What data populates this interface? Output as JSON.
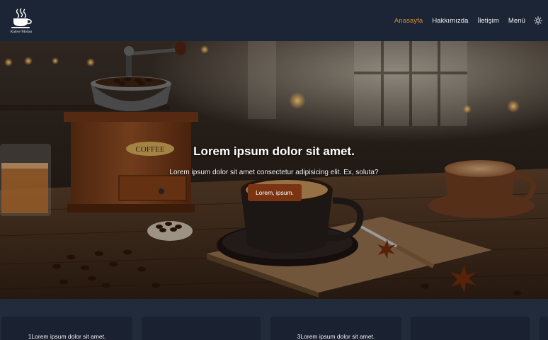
{
  "brand": {
    "name": "Kahve Molası",
    "icon": "coffee-cup-icon"
  },
  "nav": {
    "items": [
      {
        "label": "Anasayfa",
        "active": true
      },
      {
        "label": "Hakkımızda",
        "active": false
      },
      {
        "label": "İletişim",
        "active": false
      },
      {
        "label": "Menü",
        "active": false
      }
    ],
    "theme_icon": "sun-icon"
  },
  "hero": {
    "title": "Lorem ipsum dolor sit amet.",
    "subtitle": "Lorem ipsum dolor sit amet consectetur adipisicing elit. Ex, soluta?",
    "button_label": "Lorem, ipsum."
  },
  "cards": [
    {
      "title": "1Lorem ipsum dolor sit amet."
    },
    {
      "title": ""
    },
    {
      "title": "3Lorem ipsum dolor sit amet."
    },
    {
      "title": ""
    },
    {
      "title": ""
    }
  ],
  "colors": {
    "navbar": "#1c2535",
    "page_bg": "#222b3b",
    "card_bg": "#1a2232",
    "accent_active": "#d98b2a",
    "button": "#7a3412"
  }
}
